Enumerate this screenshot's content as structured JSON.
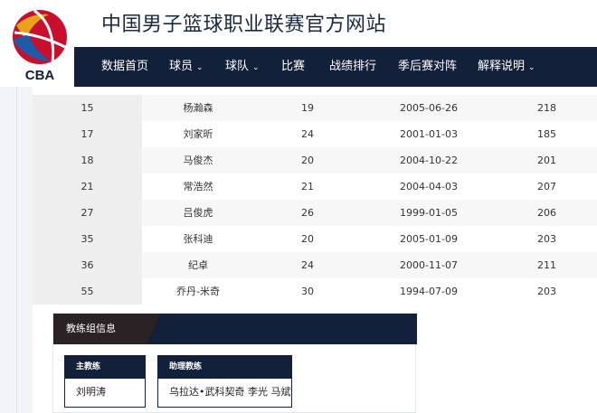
{
  "site": {
    "title": "中国男子篮球职业联赛官方网站",
    "logo_text": "CBA",
    "colors": {
      "navy": "#13203a",
      "red": "#c8102e",
      "gold": "#e8a31b",
      "blue": "#1e5aa8"
    }
  },
  "nav": {
    "items": [
      {
        "label": "数据首页",
        "dropdown": false
      },
      {
        "label": "球员",
        "dropdown": true
      },
      {
        "label": "球队",
        "dropdown": true
      },
      {
        "label": "比赛",
        "dropdown": false
      },
      {
        "label": "战绩排行",
        "dropdown": false
      },
      {
        "label": "季后赛对阵",
        "dropdown": false
      },
      {
        "label": "解释说明",
        "dropdown": true
      }
    ]
  },
  "roster": {
    "rows": [
      {
        "number": "15",
        "name": "杨瀚森",
        "age": "19",
        "birthdate": "2005-06-26",
        "height": "218"
      },
      {
        "number": "17",
        "name": "刘家昕",
        "age": "24",
        "birthdate": "2001-01-03",
        "height": "185"
      },
      {
        "number": "18",
        "name": "马俊杰",
        "age": "20",
        "birthdate": "2004-10-22",
        "height": "201"
      },
      {
        "number": "21",
        "name": "常浩然",
        "age": "21",
        "birthdate": "2004-04-03",
        "height": "207"
      },
      {
        "number": "27",
        "name": "吕俊虎",
        "age": "26",
        "birthdate": "1999-01-05",
        "height": "206"
      },
      {
        "number": "35",
        "name": "张科迪",
        "age": "20",
        "birthdate": "2005-01-09",
        "height": "203"
      },
      {
        "number": "36",
        "name": "纪卓",
        "age": "24",
        "birthdate": "2000-11-07",
        "height": "211"
      },
      {
        "number": "55",
        "name": "乔丹-米奇",
        "age": "30",
        "birthdate": "1994-07-09",
        "height": "203"
      }
    ]
  },
  "coaching": {
    "title": "教练组信息",
    "head_coach": {
      "label": "主教练",
      "names": "刘明涛"
    },
    "assistants": {
      "label": "助理教练",
      "names": "乌拉达•武科契奇 李光 马斌"
    }
  }
}
